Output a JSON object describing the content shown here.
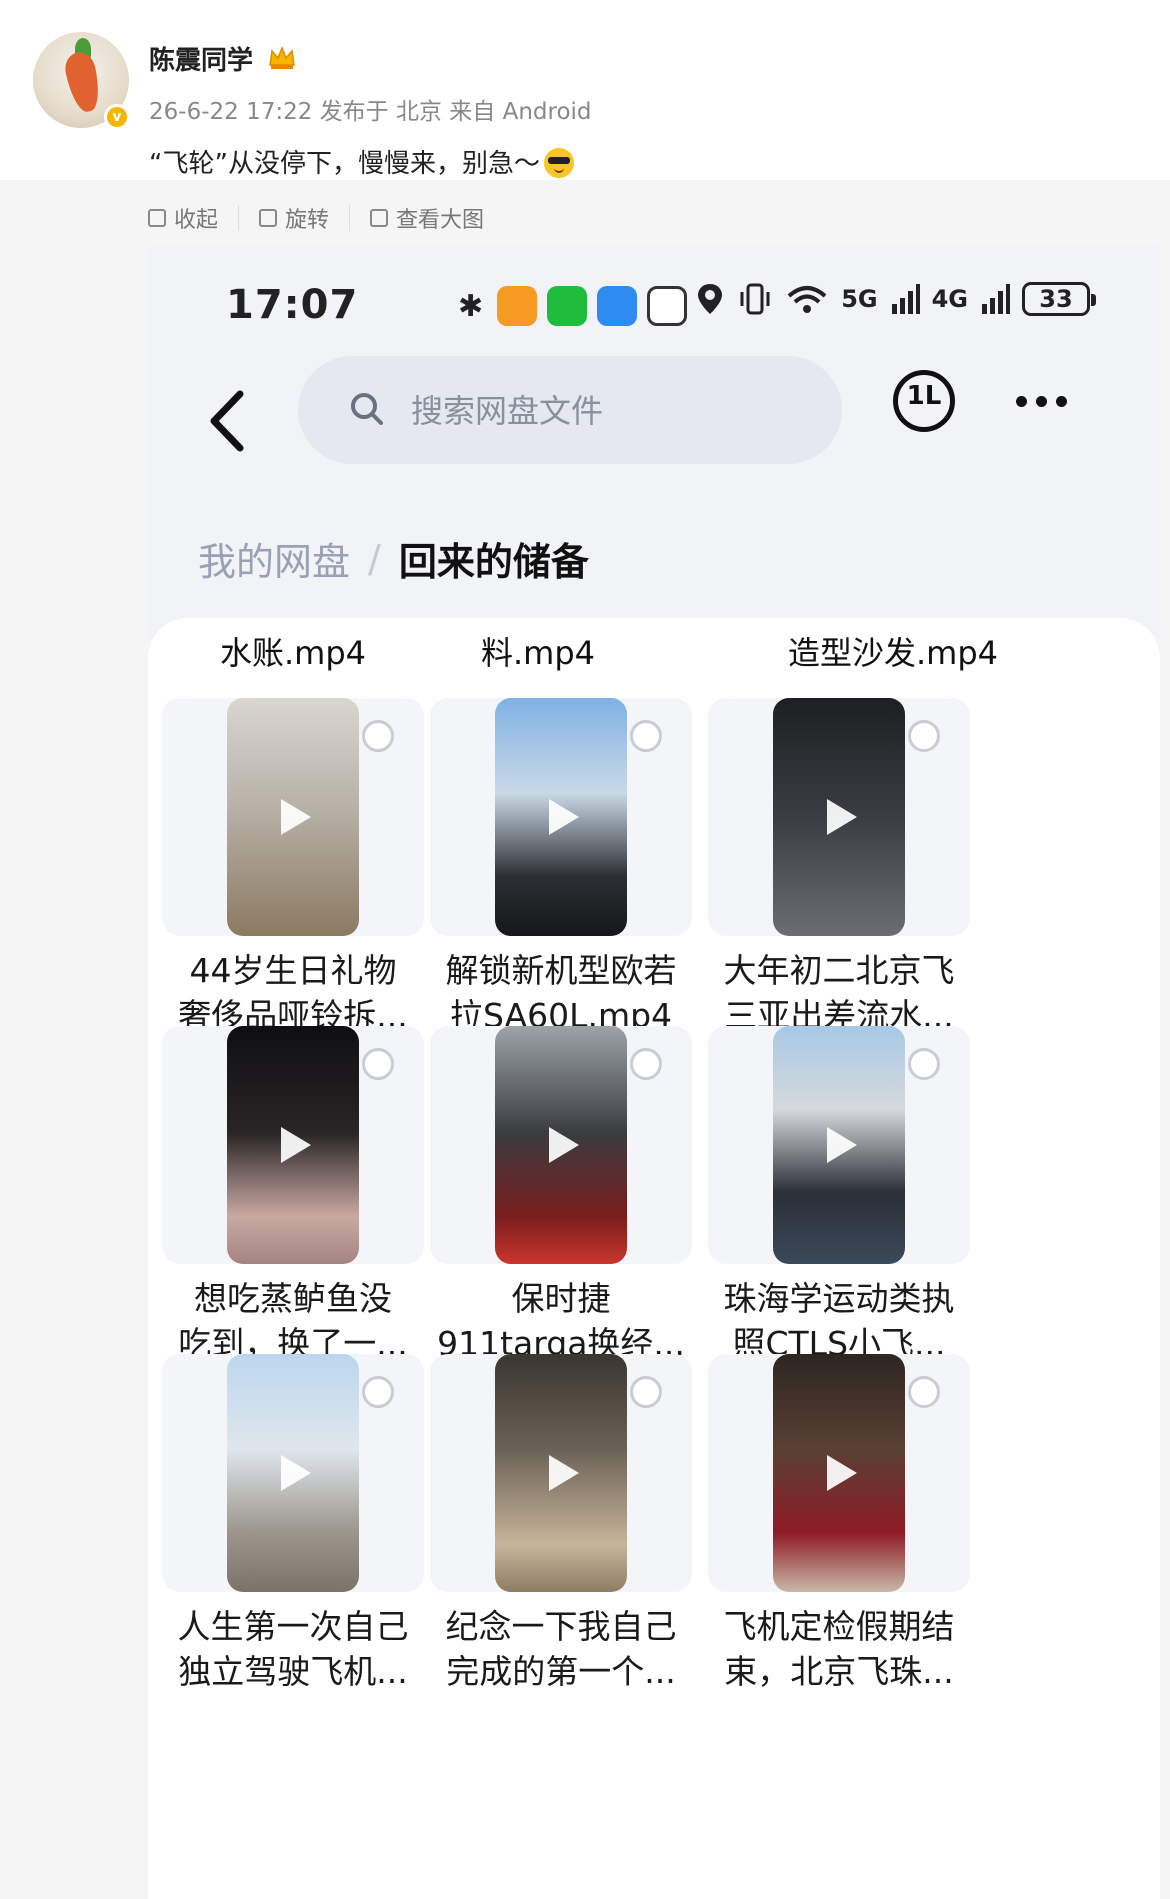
{
  "post": {
    "username": "陈震同学",
    "verified_mark": "v",
    "meta": "26-6-22 17:22 发布于 北京 来自 Android",
    "text": "“飞轮”从没停下，慢慢来，别急～"
  },
  "toolbar": {
    "collapse_label": "收起",
    "rotate_label": "旋转",
    "view_large_label": "查看大图"
  },
  "status_bar": {
    "time": "17:07",
    "signal_5g": "5G",
    "signal_4g": "4G",
    "battery": "33"
  },
  "header": {
    "search_placeholder": "搜索网盘文件",
    "sort_label": "1L"
  },
  "breadcrumb": {
    "root": "我的网盘",
    "separator": "/",
    "current": "回来的储备"
  },
  "partial_row": [
    "水账.mp4",
    "料.mp4",
    "造型沙发.mp4"
  ],
  "files": [
    {
      "line1": "44岁生日礼物",
      "line2": "奢侈品哑铃拆..."
    },
    {
      "line1": "解锁新机型欧若",
      "line2": "拉SA60L.mp4"
    },
    {
      "line1": "大年初二北京飞",
      "line2": "三亚出差流水..."
    },
    {
      "line1": "想吃蒸鲈鱼没",
      "line2": "吃到，换了一..."
    },
    {
      "line1": "保时捷",
      "line2": "911targa换经..."
    },
    {
      "line1": "珠海学运动类执",
      "line2": "照CTLS小飞..."
    },
    {
      "line1": "人生第一次自己",
      "line2": "独立驾驶飞机..."
    },
    {
      "line1": "纪念一下我自己",
      "line2": "完成的第一个..."
    },
    {
      "line1": "飞机定检假期结",
      "line2": "束，北京飞珠..."
    }
  ],
  "colors": {
    "accent_gold": "#f7b500",
    "search_bg": "#e6e8ef",
    "page_bg": "#f2f3f7"
  }
}
